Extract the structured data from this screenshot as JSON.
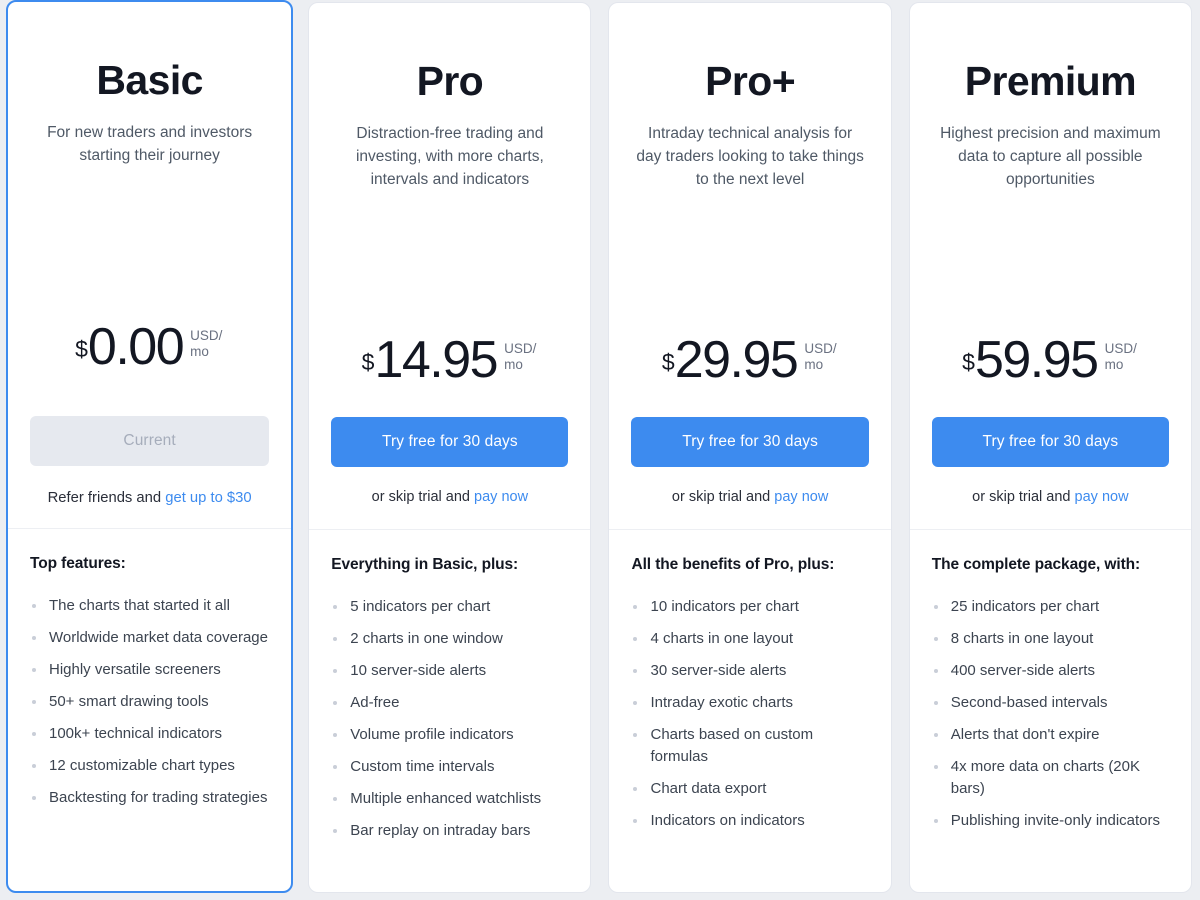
{
  "theme": {
    "accent_blue": "#3d8bef",
    "page_background": "#eceef2",
    "card_background": "#ffffff",
    "disabled_button_background": "#e6e9ef",
    "disabled_button_text": "#a6adbb",
    "bullet_color": "#c9ced8"
  },
  "plans": [
    {
      "id": "basic",
      "name": "Basic",
      "tagline": "For new traders and investors starting their journey",
      "currency_symbol": "$",
      "price": "0.00",
      "period": "USD/ mo",
      "highlighted": true,
      "cta": {
        "label": "Current",
        "disabled": true
      },
      "subtext": {
        "prefix": "Refer friends and ",
        "link": "get up to $30"
      },
      "features_heading": "Top features:",
      "features": [
        "The charts that started it all",
        "Worldwide market data coverage",
        "Highly versatile screeners",
        "50+ smart drawing tools",
        "100k+ technical indicators",
        "12 customizable chart types",
        "Backtesting for trading strategies"
      ]
    },
    {
      "id": "pro",
      "name": "Pro",
      "tagline": "Distraction-free trading and investing, with more charts, intervals and indicators",
      "currency_symbol": "$",
      "price": "14.95",
      "period": "USD/ mo",
      "highlighted": false,
      "cta": {
        "label": "Try free for 30 days",
        "disabled": false
      },
      "subtext": {
        "prefix": "or skip trial and ",
        "link": "pay now"
      },
      "features_heading": "Everything in Basic, plus:",
      "features": [
        "5 indicators per chart",
        "2 charts in one window",
        "10 server-side alerts",
        "Ad-free",
        "Volume profile indicators",
        "Custom time intervals",
        "Multiple enhanced watchlists",
        "Bar replay on intraday bars"
      ]
    },
    {
      "id": "pro-plus",
      "name": "Pro+",
      "tagline": "Intraday technical analysis for day traders looking to take things to the next level",
      "currency_symbol": "$",
      "price": "29.95",
      "period": "USD/ mo",
      "highlighted": false,
      "cta": {
        "label": "Try free for 30 days",
        "disabled": false
      },
      "subtext": {
        "prefix": "or skip trial and ",
        "link": "pay now"
      },
      "features_heading": "All the benefits of Pro, plus:",
      "features": [
        "10 indicators per chart",
        "4 charts in one layout",
        "30 server-side alerts",
        "Intraday exotic charts",
        "Charts based on custom formulas",
        "Chart data export",
        "Indicators on indicators"
      ]
    },
    {
      "id": "premium",
      "name": "Premium",
      "tagline": "Highest precision and maximum data to capture all possible opportunities",
      "currency_symbol": "$",
      "price": "59.95",
      "period": "USD/ mo",
      "highlighted": false,
      "cta": {
        "label": "Try free for 30 days",
        "disabled": false
      },
      "subtext": {
        "prefix": "or skip trial and ",
        "link": "pay now"
      },
      "features_heading": "The complete package, with:",
      "features": [
        "25 indicators per chart",
        "8 charts in one layout",
        "400 server-side alerts",
        "Second-based intervals",
        "Alerts that don't expire",
        "4x more data on charts (20K bars)",
        "Publishing invite-only indicators"
      ]
    }
  ]
}
